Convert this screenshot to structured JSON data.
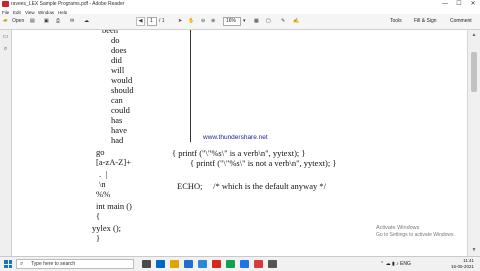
{
  "window": {
    "title": "ravees_LEX Sample Programs.pdf - Adobe Reader",
    "controls": [
      "—",
      "☐",
      "✕"
    ]
  },
  "menu": [
    "File",
    "Edit",
    "View",
    "Window",
    "Help"
  ],
  "toolbar": {
    "open_label": "Open",
    "page_current": "1",
    "page_total": "/ 1",
    "zoom": "16%",
    "tools_label": "Tools",
    "fill_sign_label": "Fill & Sign",
    "comment_label": "Comment"
  },
  "document": {
    "code_lines": [
      "been",
      "do",
      "does",
      "did",
      "will",
      "would",
      "should",
      "can",
      "could",
      "has",
      "have",
      "had",
      "go",
      "[a-zA-Z]+",
      ".  |",
      "\\n",
      "%%",
      "int main ()",
      "{",
      "yylex ();",
      "}"
    ],
    "action_1": "{ printf (\"\\\"%s\\\" is a verb\\n\", yytext); }",
    "action_2": "{ printf (\"\\\"%s\\\" is not a verb\\n\", yytext); }",
    "action_3": "ECHO;     /* which is the default anyway */",
    "watermark": "www.thundershare.net"
  },
  "activate": {
    "line1": "Activate Windows",
    "line2": "Go to Settings to activate Windows."
  },
  "taskbar": {
    "search_placeholder": "Type here to search",
    "time": "11:41",
    "date": "16-05-2021",
    "app_colors": [
      "#4a4a4a",
      "#0067c0",
      "#e0a400",
      "#1f6fd1",
      "#2b88d8",
      "#d8261c",
      "#12a150",
      "#1e73e8",
      "#d93a3a",
      "#555555"
    ]
  }
}
